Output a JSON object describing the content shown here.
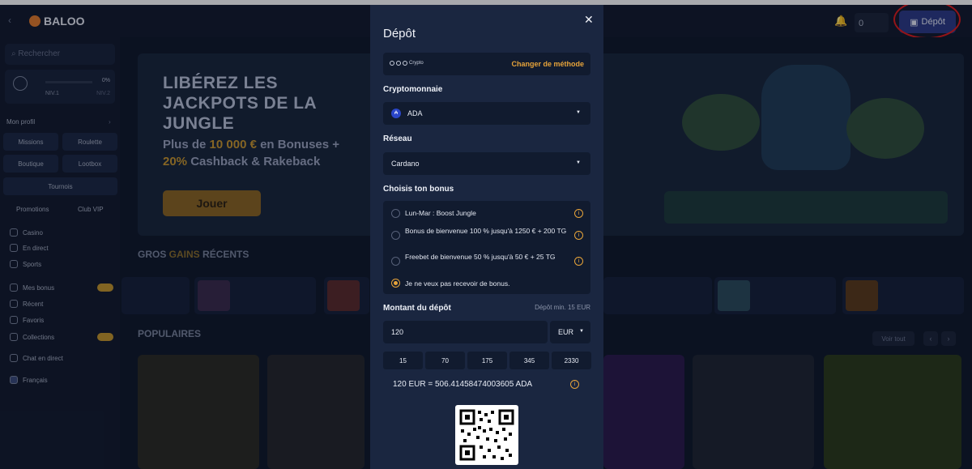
{
  "header": {
    "logo_text": "BALOO",
    "balance": "0",
    "deposit_label": "Dépôt"
  },
  "sidebar": {
    "search_placeholder": "Rechercher",
    "profile": {
      "level_start": "NIV.1",
      "level_end": "NIV.2",
      "progress": "0%"
    },
    "my_profile": "Mon profil",
    "grid": [
      "Missions",
      "Roulette",
      "Boutique",
      "Lootbox",
      "Tournois"
    ],
    "promotions": "Promotions",
    "vip": "Club VIP",
    "nav": [
      "Casino",
      "En direct",
      "Sports"
    ],
    "nav2": [
      "Mes bonus",
      "Récent",
      "Favoris",
      "Collections"
    ],
    "chat": "Chat en direct",
    "language": "Français"
  },
  "banner": {
    "title": "LIBÉREZ LES JACKPOTS DE LA JUNGLE",
    "sub_1": "Plus de ",
    "sub_amount": "10 000 €",
    "sub_2": " en Bonuses + ",
    "sub_pct": "20%",
    "sub_3": " Cashback & Rakeback",
    "cta": "Jouer"
  },
  "sections": {
    "big_wins_1": "GROS ",
    "big_wins_2": "GAINS",
    "big_wins_3": " RÉCENTS",
    "popular": "POPULAIRES",
    "see_all": "Voir tout"
  },
  "modal": {
    "title": "Dépôt",
    "method_name": "Crypto",
    "change_method": "Changer de méthode",
    "crypto_label": "Cryptomonnaie",
    "crypto_value": "ADA",
    "network_label": "Réseau",
    "network_value": "Cardano",
    "bonus_label": "Choisis ton bonus",
    "bonuses": [
      {
        "text": "Lun-Mar : Boost Jungle",
        "selected": false
      },
      {
        "text": "Bonus de bienvenue 100 % jusqu'à 1250 € + 200 TG",
        "selected": false
      },
      {
        "text": "Freebet de bienvenue 50 % jusqu'à 50 € + 25 TG",
        "selected": false
      },
      {
        "text": "Je ne veux pas recevoir de bonus.",
        "selected": true
      }
    ],
    "amount_label": "Montant du dépôt",
    "amount_min": "Dépôt min. 15 EUR",
    "amount_value": "120",
    "currency": "EUR",
    "quick_amounts": [
      "15",
      "70",
      "175",
      "345",
      "2330"
    ],
    "conversion": "120 EUR = 506.41458474003605 ADA"
  },
  "colors": {
    "accent": "#e6a33a",
    "modal_bg": "#1a2640",
    "brand_button": "#2b3a86",
    "annotation_red": "#e11b1b"
  }
}
